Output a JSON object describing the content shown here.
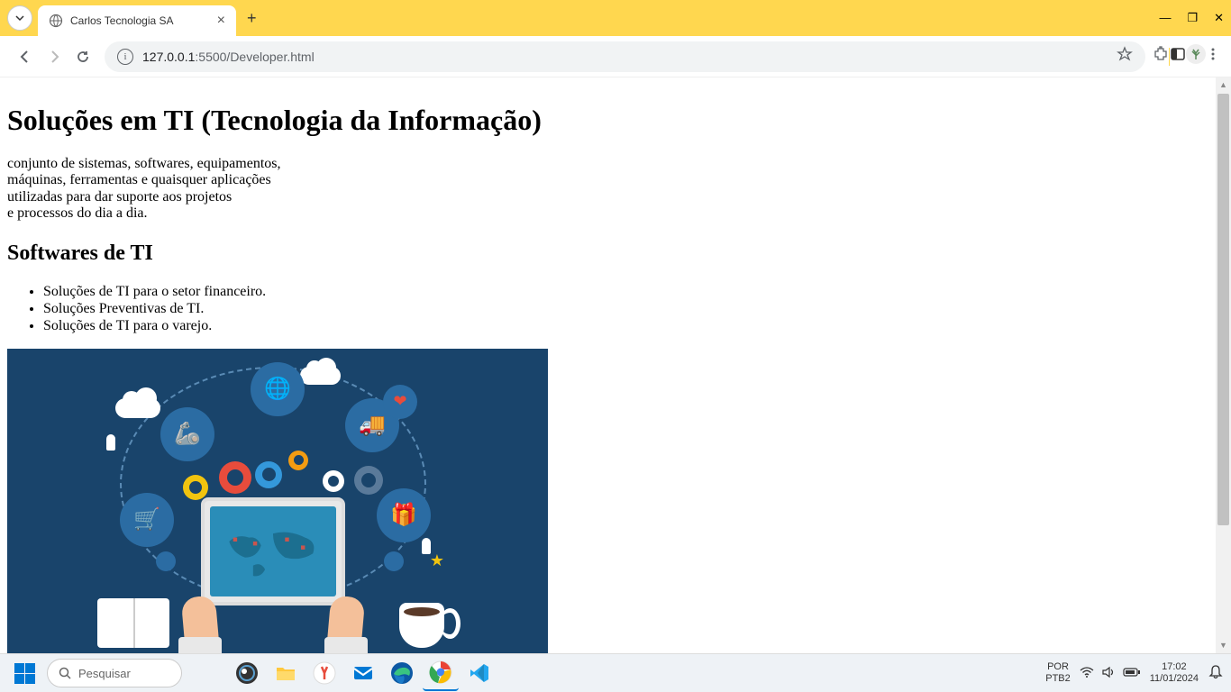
{
  "browser": {
    "tab_title": "Carlos Tecnologia SA",
    "url_host": "127.0.0.1",
    "url_port_path": ":5500/Developer.html"
  },
  "page": {
    "h1": "Soluções em TI (Tecnologia da Informação)",
    "intro_line1": "conjunto de sistemas, softwares, equipamentos,",
    "intro_line2": "máquinas, ferramentas e quaisquer aplicações",
    "intro_line3": "utilizadas para dar suporte aos projetos",
    "intro_line4": "e processos do dia a dia.",
    "h2": "Softwares de TI",
    "list": [
      "Soluções de TI para o setor financeiro.",
      "Soluções Preventivas de TI.",
      "Soluções de TI para o varejo."
    ]
  },
  "taskbar": {
    "search_placeholder": "Pesquisar",
    "lang": "POR",
    "kbd": "PTB2",
    "time": "17:02",
    "date": "11/01/2024"
  }
}
